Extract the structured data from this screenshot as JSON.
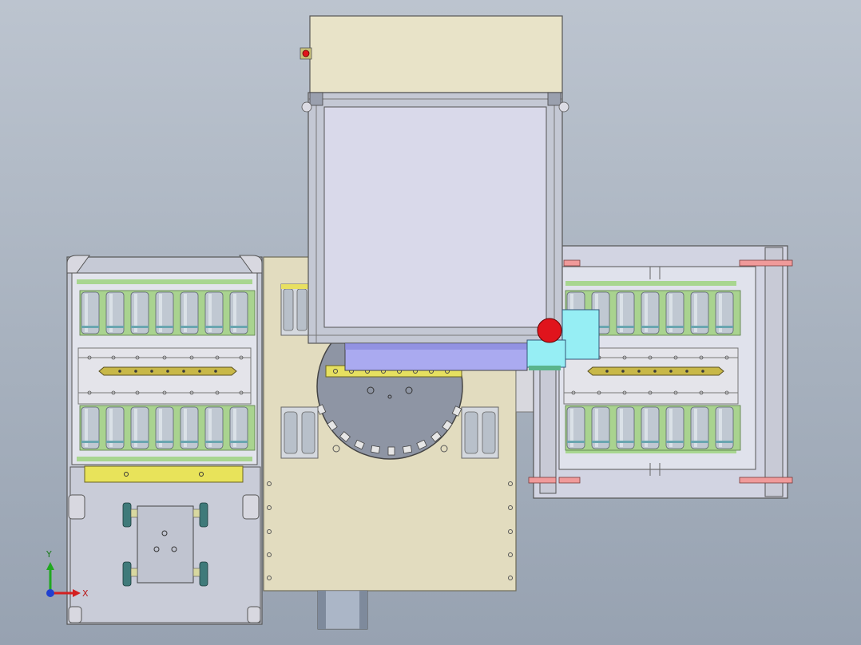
{
  "viewport": {
    "triad": {
      "x_label": "X",
      "y_label": "Y"
    }
  },
  "colors": {
    "background_top": "#bcc4cf",
    "background_bottom": "#97a2b1",
    "cabinet_beige": "#e8e3c8",
    "panel_lavender": "#d9d9ea",
    "frame_gray": "#c4c8d4",
    "roller_green": "#a9d38f",
    "roller_steel": "#c0c8d2",
    "bracket_yellow": "#e8e35a",
    "cylinder_blue": "#aaaaf0",
    "cyan_block": "#96eef4",
    "indicator_red": "#e0141c",
    "accent_pink": "#f09a9a",
    "turntable_gray": "#8e95a4",
    "axis_x": "#d42020",
    "axis_y": "#20a820",
    "axis_z": "#2040d0"
  }
}
